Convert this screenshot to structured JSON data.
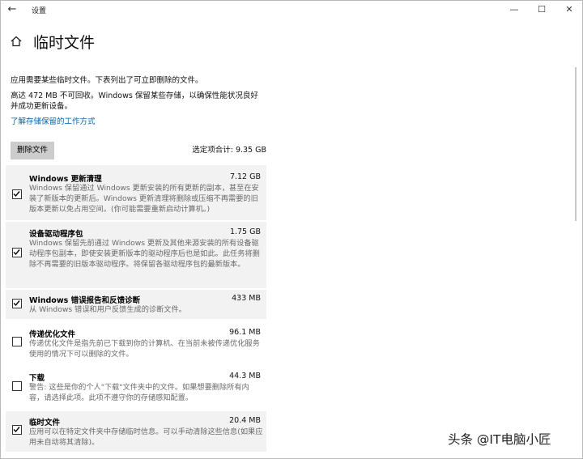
{
  "window": {
    "title": "设置",
    "back_glyph": "←",
    "minimize_glyph": "—",
    "maximize_glyph": "☐",
    "close_glyph": "✕"
  },
  "page": {
    "title": "临时文件",
    "intro": "应用需要某些临时文件。下表列出了可立即删除的文件。",
    "note_line1": "高达 472 MB 不可回收。Windows 保留某些存储，以确保性能状况良好",
    "note_line2": "并成功更新设备。",
    "link": "了解存储保留的工作方式",
    "delete_button": "删除文件",
    "selected_total": "选定项合计: 9.35 GB"
  },
  "items": [
    {
      "name": "Windows 更新清理",
      "size": "7.12 GB",
      "checked": true,
      "desc": "Windows 保留通过 Windows 更新安装的所有更新的副本，甚至在安装了新版本的更新后。Windows 更新清理将删除或压缩不再需要的旧版本更新以免占用空间。(你可能需要重新启动计算机。)"
    },
    {
      "name": "设备驱动程序包",
      "size": "1.75 GB",
      "checked": true,
      "desc": "Windows 保留先前通过 Windows 更新及其他来源安装的所有设备驱动程序包副本，即使安装更新版本的驱动程序后也是如此。此任务将删除不再需要的旧版本驱动程序。将保留各驱动程序包的最新版本。"
    },
    {
      "name": "Windows 错误报告和反馈诊断",
      "size": "433 MB",
      "checked": true,
      "desc": "从 Windows 错误和用户反馈生成的诊断文件。"
    },
    {
      "name": "传递优化文件",
      "size": "96.1 MB",
      "checked": false,
      "desc": "传递优化文件是指先前已下载到你的计算机、在当前未被传递优化服务使用的情况下可以删除的文件。"
    },
    {
      "name": "下载",
      "size": "44.3 MB",
      "checked": false,
      "desc": "警告: 这些是你的个人\"下载\"文件夹中的文件。如果想要删除所有内容，请选择此项。此项不遵守你的存储感知配置。"
    },
    {
      "name": "临时文件",
      "size": "20.4 MB",
      "checked": true,
      "desc": "应用可以在特定文件夹中存储临时信息。可以手动清除这些信息(如果应用未自动将其清除)。"
    }
  ],
  "watermark": "头条 @IT电脑小匠",
  "icons": {
    "home": "home-icon",
    "check": "check-icon"
  },
  "colors": {
    "link": "#0063b1",
    "button": "#cccccc",
    "selected_row": "#f2f2f2"
  }
}
